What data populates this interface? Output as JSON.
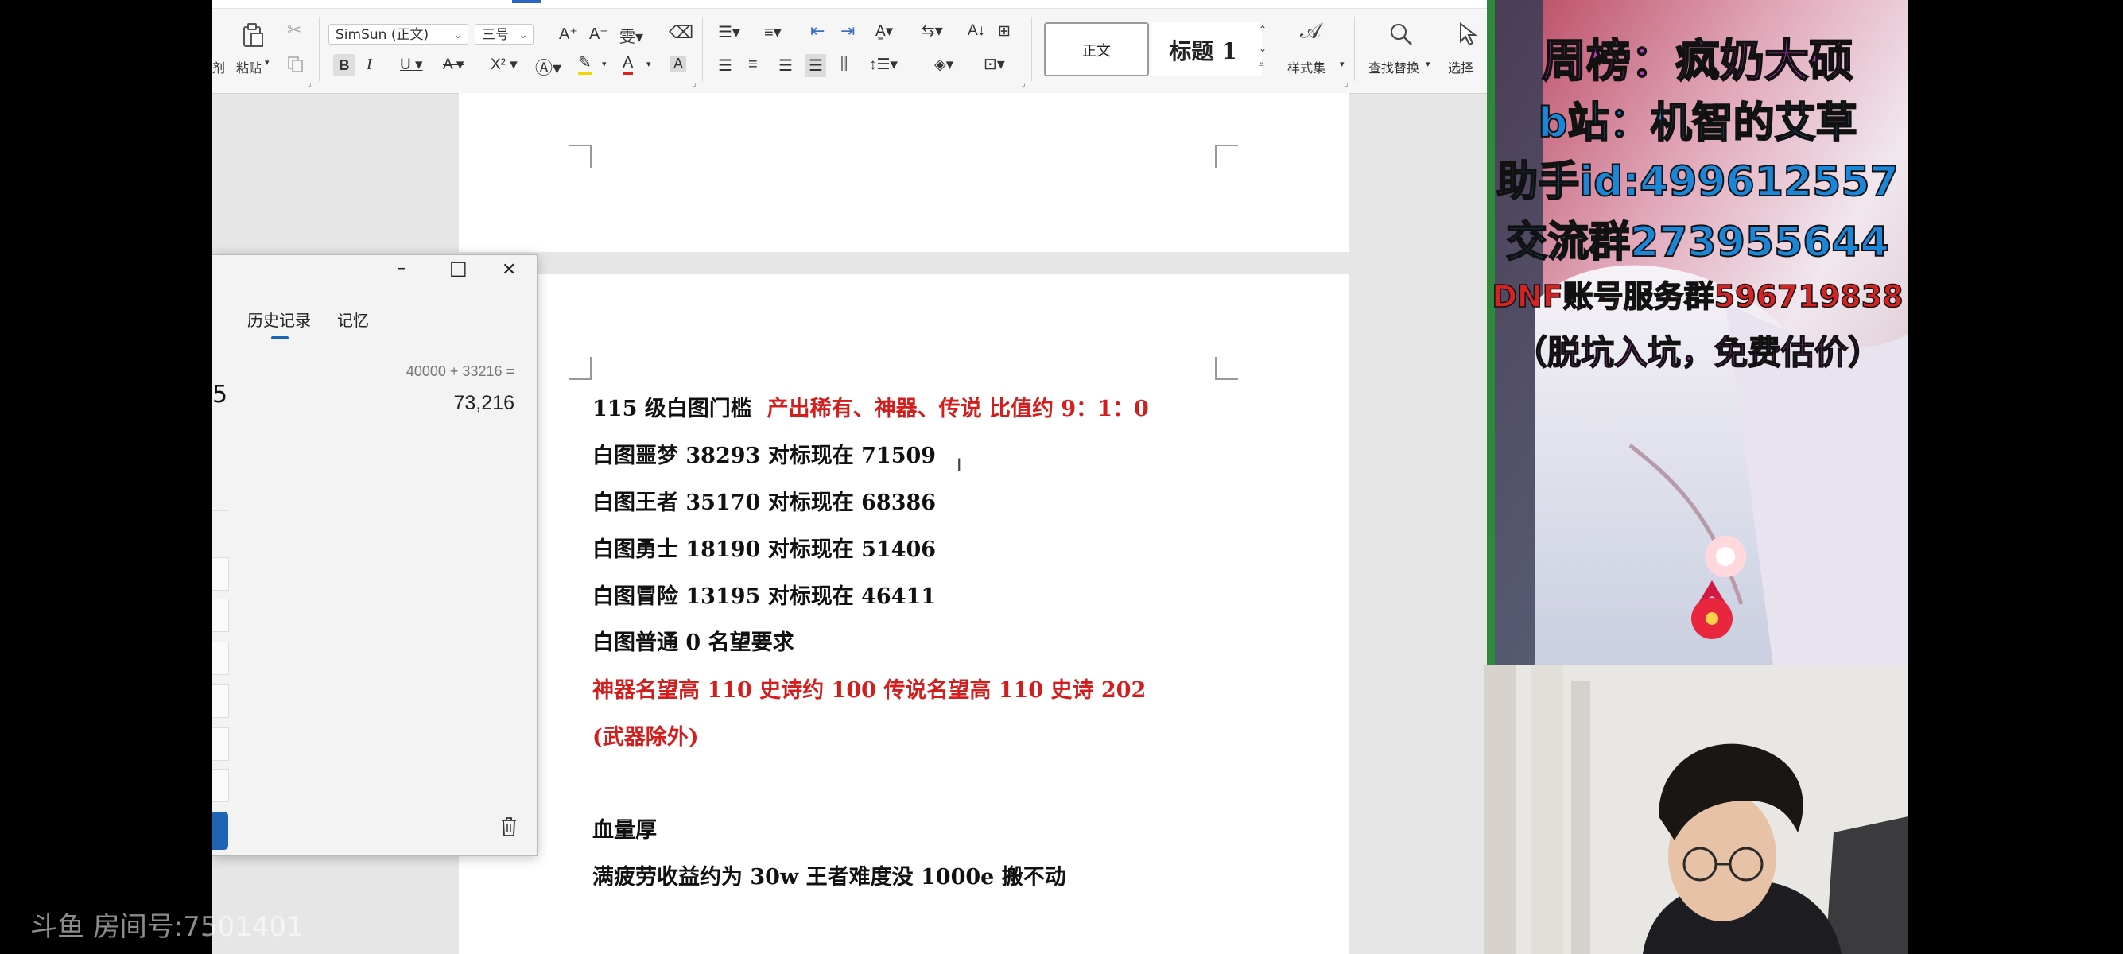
{
  "ribbon": {
    "clipboard": {
      "cut_partial": "剂",
      "paste_label": "粘贴"
    },
    "font": {
      "family": "SimSun (正文)",
      "size": "三号"
    },
    "styles": {
      "normal": "正文",
      "heading1": "标题 1",
      "style_set": "样式集"
    },
    "find_replace": "查找替换",
    "select": "选择",
    "icons": {
      "paste": "paste-icon",
      "cut": "scissors-icon",
      "copy": "copy-icon",
      "grow_font": "grow-font-icon",
      "shrink_font": "shrink-font-icon",
      "phonetic": "phonetic-guide-icon",
      "clear_format": "eraser-icon",
      "bold": "B",
      "italic": "I",
      "underline": "U",
      "strike": "strikethrough-icon",
      "superscript": "X²",
      "text_effect": "text-effect-icon",
      "highlight": "highlighter-icon",
      "font_color": "font-color-icon",
      "char_shading": "char-shading-icon",
      "bullets": "bullet-list-icon",
      "numbering": "numbered-list-icon",
      "decrease_indent": "decrease-indent-icon",
      "increase_indent": "increase-indent-icon",
      "chinese_layout": "chinese-layout-icon",
      "text_direction": "text-direction-icon",
      "sort": "sort-icon",
      "show_marks": "show-marks-icon",
      "align_left": "align-left-icon",
      "align_center": "align-center-icon",
      "align_right": "align-right-icon",
      "justify": "justify-icon",
      "distributed": "distributed-icon",
      "line_spacing": "line-spacing-icon",
      "shading": "shading-icon",
      "borders": "border-icon",
      "search": "search-icon",
      "cursor": "cursor-select-icon"
    }
  },
  "calculator": {
    "tabs": {
      "history": "历史记录",
      "memory": "记忆"
    },
    "history": {
      "expression": "40000  +  33216 =",
      "result": "73,216"
    },
    "partial_display": "5",
    "window_controls": {
      "minimize": "–",
      "maximize": "□",
      "close": "✕"
    }
  },
  "document": {
    "lines": [
      {
        "prefix": "115 级白图门槛",
        "highlight": "产出稀有、神器、传说    比值约 9：1：0"
      },
      {
        "text": "白图噩梦 38293    对标现在 71509"
      },
      {
        "text": "白图王者 35170    对标现在 68386"
      },
      {
        "text": "白图勇士 18190    对标现在 51406"
      },
      {
        "text": "白图冒险 13195    对标现在 46411"
      },
      {
        "text": "白图普通 0 名望要求"
      },
      {
        "text": "神器名望高 110 史诗约 100    传说名望高 110 史诗 202"
      },
      {
        "text": "(武器除外)"
      },
      {
        "text": "血量厚"
      },
      {
        "text": "满疲劳收益约为 30w    王者难度没 1000e 搬不动"
      }
    ]
  },
  "overlay": {
    "lines": [
      "周榜：疯奶大硕",
      "b站：机智的艾草",
      "助手id:499612557",
      "交流群273955644",
      "DNF账号服务群596719838",
      "（脱坑入坑，免费估价）"
    ],
    "colors": {
      "fill": "#1b86d8",
      "fill2": "#c637c6",
      "outline": "#111111"
    }
  },
  "watermark": {
    "brand": "斗鱼",
    "room": "房间号:7501401"
  }
}
